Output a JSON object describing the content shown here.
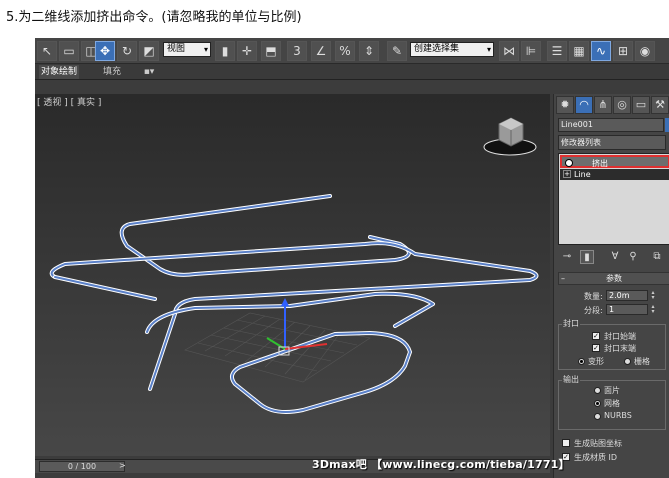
{
  "caption": "5.为二维线添加挤出命令。(请忽略我的单位与比例)",
  "toolbar": {
    "view_dropdown": "视图",
    "selection_set_dropdown": "创建选择集",
    "icons": [
      "select-icon",
      "rect-select-icon",
      "window-crossing-icon",
      "move-icon",
      "rotate-icon",
      "scale-icon",
      "snap-3-icon",
      "angle-snap-icon",
      "percent-snap-icon",
      "spinner-snap-icon",
      "edit-named-sel-icon",
      "mirror-icon",
      "align-icon",
      "layer-icon",
      "graphite-icon",
      "curve-editor-icon",
      "schematic-icon",
      "material-editor-icon",
      "render-setup-icon",
      "render-frame-icon"
    ]
  },
  "ribbon": {
    "tabs": [
      "对象绘制",
      "填充"
    ]
  },
  "viewport": {
    "label": "[ 透视 ] [ 真实 ]"
  },
  "timeline": {
    "frame": "0 / 100",
    "next": ">"
  },
  "command_panel": {
    "object_name": "Line001",
    "modifier_list": "修改器列表",
    "stack": {
      "extrude": "挤出",
      "line": "Line"
    },
    "params_title": "参数",
    "amount_label": "数量:",
    "amount_value": "2.0m",
    "segments_label": "分段:",
    "segments_value": "1",
    "capping_title": "封口",
    "cap_start": "封口始端",
    "cap_end": "封口末端",
    "morph": "变形",
    "grid": "栅格",
    "output_title": "输出",
    "out_patch": "面片",
    "out_mesh": "网格",
    "out_nurbs": "NURBS",
    "gen_mapping": "生成贴图坐标",
    "gen_mat_id": "生成材质 ID"
  },
  "watermark": "3Dmax吧 【www.linecg.com/tieba/1771】"
}
